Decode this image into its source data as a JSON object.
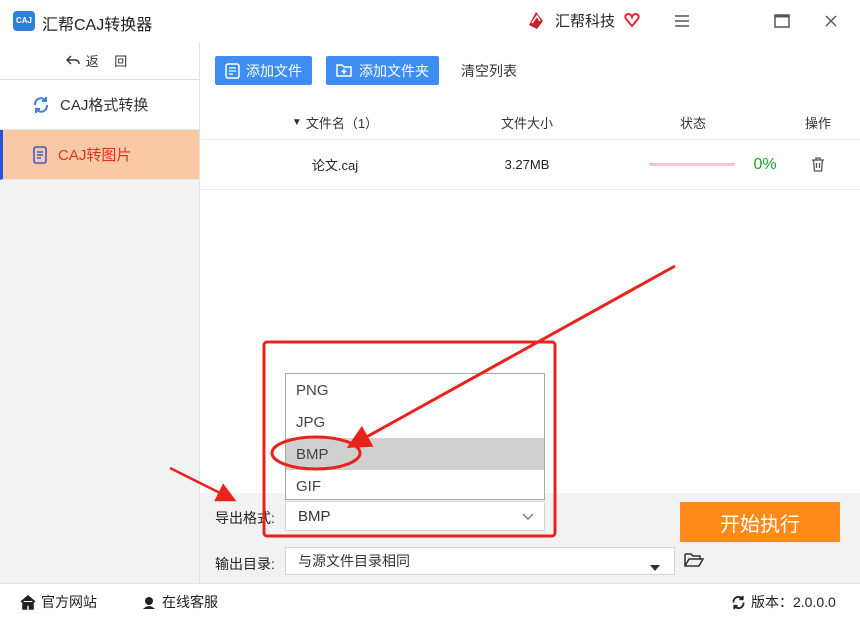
{
  "app": {
    "icon_text": "CAJ",
    "title": "汇帮CAJ转换器",
    "brand": "汇帮科技"
  },
  "sidebar": {
    "back_label": "返 回",
    "items": [
      {
        "label": "CAJ格式转换",
        "icon": "refresh-icon"
      },
      {
        "label": "CAJ转图片",
        "icon": "document-icon"
      }
    ]
  },
  "toolbar": {
    "add_file": "添加文件",
    "add_folder": "添加文件夹",
    "clear_list": "清空列表"
  },
  "table": {
    "headers": {
      "name": "文件名（1）",
      "size": "文件大小",
      "status": "状态",
      "action": "操作"
    },
    "rows": [
      {
        "name": "论文.caj",
        "size": "3.27MB",
        "progress": "0%"
      }
    ]
  },
  "export": {
    "format_label": "导出格式:",
    "format_value": "BMP",
    "options": [
      "PNG",
      "JPG",
      "BMP",
      "GIF"
    ],
    "highlighted_option": "BMP",
    "dir_label": "输出目录:",
    "dir_value": "与源文件目录相同",
    "start_label": "开始执行"
  },
  "statusbar": {
    "website": "官方网站",
    "support": "在线客服",
    "version": "版本：2.0.0.0"
  },
  "colors": {
    "accent_blue": "#3d8ef0",
    "active_nav_bg": "#f8c9a4",
    "active_nav_text": "#e0331c",
    "start_btn": "#ff8a1a",
    "annotation_red": "#e8231c",
    "progress_green": "#1fa11f"
  }
}
